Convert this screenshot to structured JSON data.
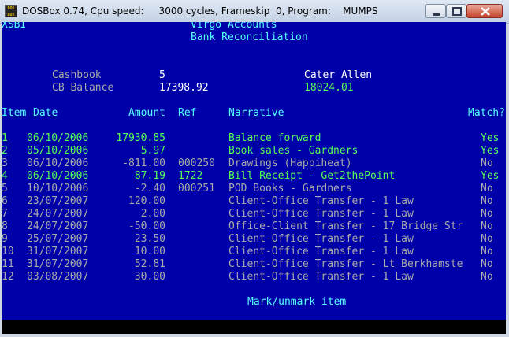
{
  "window": {
    "title": "DOSBox 0.74, Cpu speed:     3000 cycles, Frameskip  0, Program:    MUMPS",
    "icon_text": "DOS BOX"
  },
  "screen": {
    "corner": "XSBI",
    "app_title": "Virgo Accounts",
    "subtitle": "Bank Reconciliation",
    "cashbook_label": "Cashbook",
    "cashbook_value": "5",
    "cashbook_name": "Cater Allen",
    "balance_label": "CB Balance",
    "balance_value": "17398.92",
    "bank_balance": "18024.01",
    "headers": {
      "item": "Item",
      "date": "Date",
      "amount": "Amount",
      "ref": "Ref",
      "narrative": "Narrative",
      "match": "Match?"
    },
    "rows": [
      {
        "item": "1",
        "date": "06/10/2006",
        "amount": "17930.85",
        "ref": "",
        "narrative": "Balance forward",
        "match": "Yes",
        "matched": true
      },
      {
        "item": "2",
        "date": "05/10/2006",
        "amount": "5.97",
        "ref": "",
        "narrative": "Book sales - Gardners",
        "match": "Yes",
        "matched": true
      },
      {
        "item": "3",
        "date": "06/10/2006",
        "amount": "-811.00",
        "ref": "000250",
        "narrative": "Drawings (Happiheat)",
        "match": "No",
        "matched": false
      },
      {
        "item": "4",
        "date": "06/10/2006",
        "amount": "87.19",
        "ref": "1722",
        "narrative": "Bill Receipt - Get2thePoint",
        "match": "Yes",
        "matched": true
      },
      {
        "item": "5",
        "date": "10/10/2006",
        "amount": "-2.40",
        "ref": "000251",
        "narrative": "POD Books - Gardners",
        "match": "No",
        "matched": false
      },
      {
        "item": "6",
        "date": "23/07/2007",
        "amount": "120.00",
        "ref": "",
        "narrative": "Client-Office Transfer - 1 Law",
        "match": "No",
        "matched": false
      },
      {
        "item": "7",
        "date": "24/07/2007",
        "amount": "2.00",
        "ref": "",
        "narrative": "Client-Office Transfer - 1 Law",
        "match": "No",
        "matched": false
      },
      {
        "item": "8",
        "date": "24/07/2007",
        "amount": "-50.00",
        "ref": "",
        "narrative": "Office-Client Transfer - 17 Bridge Str",
        "match": "No",
        "matched": false
      },
      {
        "item": "9",
        "date": "25/07/2007",
        "amount": "23.50",
        "ref": "",
        "narrative": "Client-Office Transfer - 1 Law",
        "match": "No",
        "matched": false
      },
      {
        "item": "10",
        "date": "31/07/2007",
        "amount": "10.00",
        "ref": "",
        "narrative": "Client-Office Transfer - 1 Law",
        "match": "No",
        "matched": false
      },
      {
        "item": "11",
        "date": "31/07/2007",
        "amount": "52.81",
        "ref": "",
        "narrative": "Client-Office Transfer - Lt Berkhamste",
        "match": "No",
        "matched": false
      },
      {
        "item": "12",
        "date": "03/08/2007",
        "amount": "30.00",
        "ref": "",
        "narrative": "Client-Office Transfer - 1 Law",
        "match": "No",
        "matched": false
      }
    ],
    "prompt": "Mark/unmark item"
  },
  "colors": {
    "screen_bg": "#0000a8",
    "matched_text": "#55ff55",
    "unmatched_text": "#aaaaaa",
    "heading_text": "#55ffff",
    "value_text": "#ffffff"
  }
}
